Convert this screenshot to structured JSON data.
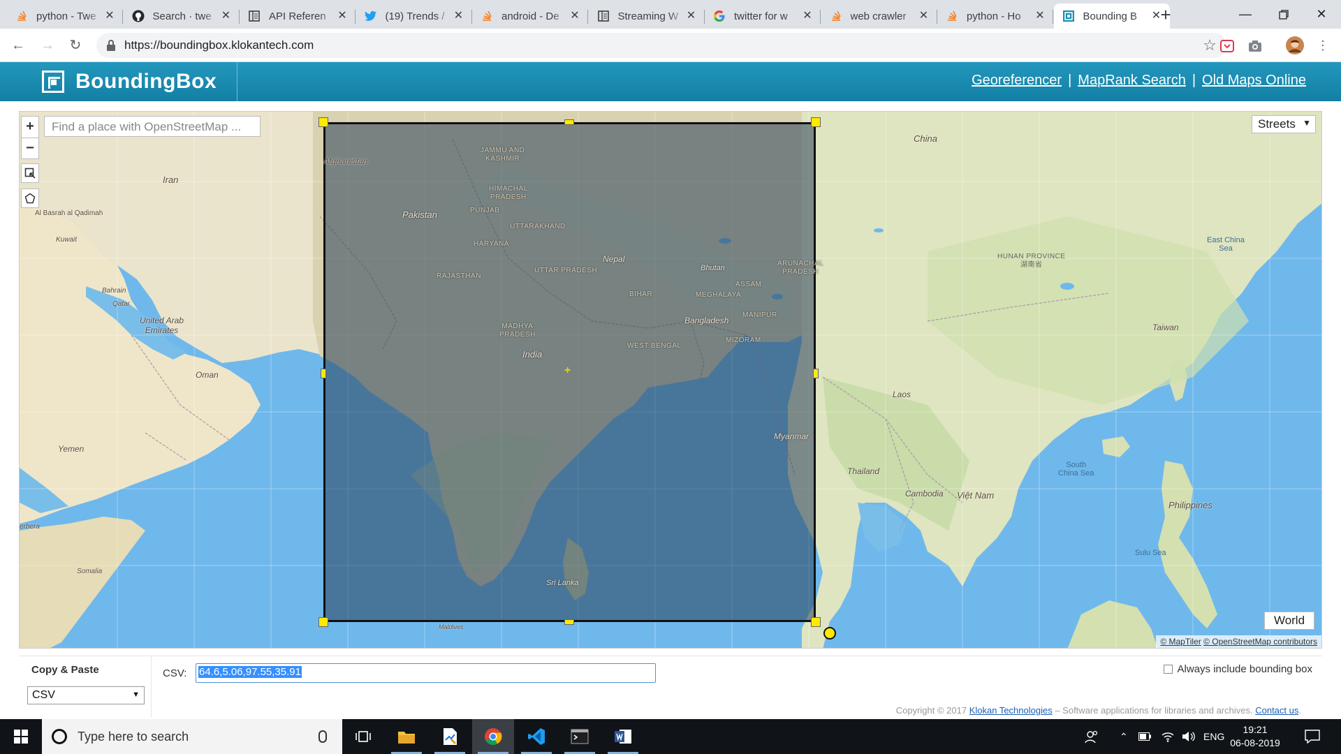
{
  "browser": {
    "tabs": [
      {
        "title": "python - Twe",
        "icon": "stackoverflow-icon",
        "active": false
      },
      {
        "title": "Search · twe",
        "icon": "github-icon",
        "active": false
      },
      {
        "title": "API Referen",
        "icon": "docs-page-icon",
        "active": false
      },
      {
        "title": "(19) Trends /",
        "icon": "twitter-icon",
        "active": false
      },
      {
        "title": "android - De",
        "icon": "stackoverflow-icon",
        "active": false
      },
      {
        "title": "Streaming W",
        "icon": "docs-page-icon",
        "active": false
      },
      {
        "title": "twitter for w",
        "icon": "google-icon",
        "active": false
      },
      {
        "title": "web crawler",
        "icon": "stackoverflow-icon",
        "active": false
      },
      {
        "title": "python - Ho",
        "icon": "stackoverflow-icon",
        "active": false
      },
      {
        "title": "Bounding B",
        "icon": "boundingbox-icon",
        "active": true
      }
    ],
    "url": "https://boundingbox.klokantech.com"
  },
  "site": {
    "brand": "BoundingBox",
    "links": [
      "Georeferencer",
      "MapRank Search",
      "Old Maps Online"
    ]
  },
  "map": {
    "search_placeholder": "Find a place with OpenStreetMap ...",
    "zoom_in": "+",
    "zoom_out": "−",
    "layer": "Streets",
    "world_button": "World",
    "attribution_maptiler": "© MapTiler",
    "attribution_osm": "© OpenStreetMap contributors",
    "labels": {
      "afghanistan": "Afghanistan",
      "iran": "Iran",
      "pakistan": "Pakistan",
      "china": "China",
      "india": "India",
      "nepal": "Nepal",
      "bhutan": "Bhutan",
      "bangladesh": "Bangladesh",
      "myanmar": "Myanmar",
      "thailand": "Thailand",
      "laos": "Laos",
      "cambodia": "Cambodia",
      "vietnam": "Việt Nam",
      "taiwan": "Taiwan",
      "philippines": "Philippines",
      "oman": "Oman",
      "yemen": "Yemen",
      "uae": "United Arab\nEmirates",
      "kuwait": "Kuwait",
      "qatar": "Qatar",
      "bahrain": "Bahrain",
      "basrah": "Al Basrah al Qadimah",
      "somalia": "Somalia",
      "srilanka": "Sri Lanka",
      "maldives": "Maldives",
      "jammu": "JAMMU AND\nKASHMIR",
      "himachal": "HIMACHAL\nPRADESH",
      "punjab": "PUNJAB",
      "uttarakhand": "UTTARAKHAND",
      "haryana": "HARYANA",
      "rajasthan": "RAJASTHAN",
      "uttar_pradesh": "UTTAR PRADESH",
      "bihar": "BIHAR",
      "madhya": "MADHYA\nPRADESH",
      "west_bengal": "WEST BENGAL",
      "assam": "ASSAM",
      "meghalaya": "MEGHALAYA",
      "manipur": "MANIPUR",
      "mizoram": "MIZORAM",
      "arunachal": "ARUNACHAL\nPRADESH",
      "hunan": "HUNAN PROVINCE\n湖南省",
      "east_china_sea": "East China\nSea",
      "south_china_sea": "South\nChina Sea",
      "sulu_sea": "Sulu Sea",
      "berbera": "erbera"
    }
  },
  "panel": {
    "title": "Copy & Paste",
    "format": "CSV",
    "csv_label": "CSV:",
    "csv_value": "64.6,5.06,97.55,35.91",
    "always_include": "Always include bounding box",
    "copyright_prefix": "Copyright © 2017",
    "copyright_link": "Klokan Technologies",
    "copyright_mid": " – Software applications for libraries and archives.",
    "contact": "Contact us"
  },
  "taskbar": {
    "search_placeholder": "Type here to search",
    "language": "ENG",
    "time": "19:21",
    "date": "06-08-2019"
  }
}
